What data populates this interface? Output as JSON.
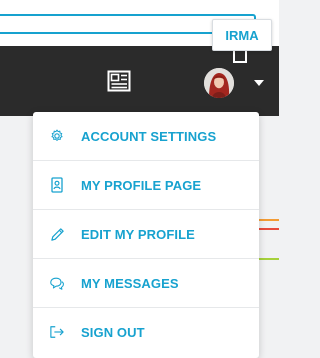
{
  "tooltip": {
    "text": "IRMA"
  },
  "header": {
    "news_icon": "newspaper-icon",
    "avatar_icon": "user-avatar",
    "dropdown_icon": "caret-down-icon"
  },
  "menu": {
    "items": [
      {
        "label": "ACCOUNT SETTINGS",
        "icon": "gear-icon"
      },
      {
        "label": "MY PROFILE PAGE",
        "icon": "id-badge-icon"
      },
      {
        "label": "EDIT MY PROFILE",
        "icon": "pencil-icon"
      },
      {
        "label": "MY MESSAGES",
        "icon": "chat-bubbles-icon"
      },
      {
        "label": "SIGN OUT",
        "icon": "sign-out-icon"
      }
    ]
  },
  "colors": {
    "accent": "#17a2cf",
    "header_bg": "#2b2b2b",
    "page_bg": "#f1f2f3",
    "line_orange": "#f39c34",
    "line_red": "#e74c3c",
    "line_green": "#a6d13b"
  }
}
